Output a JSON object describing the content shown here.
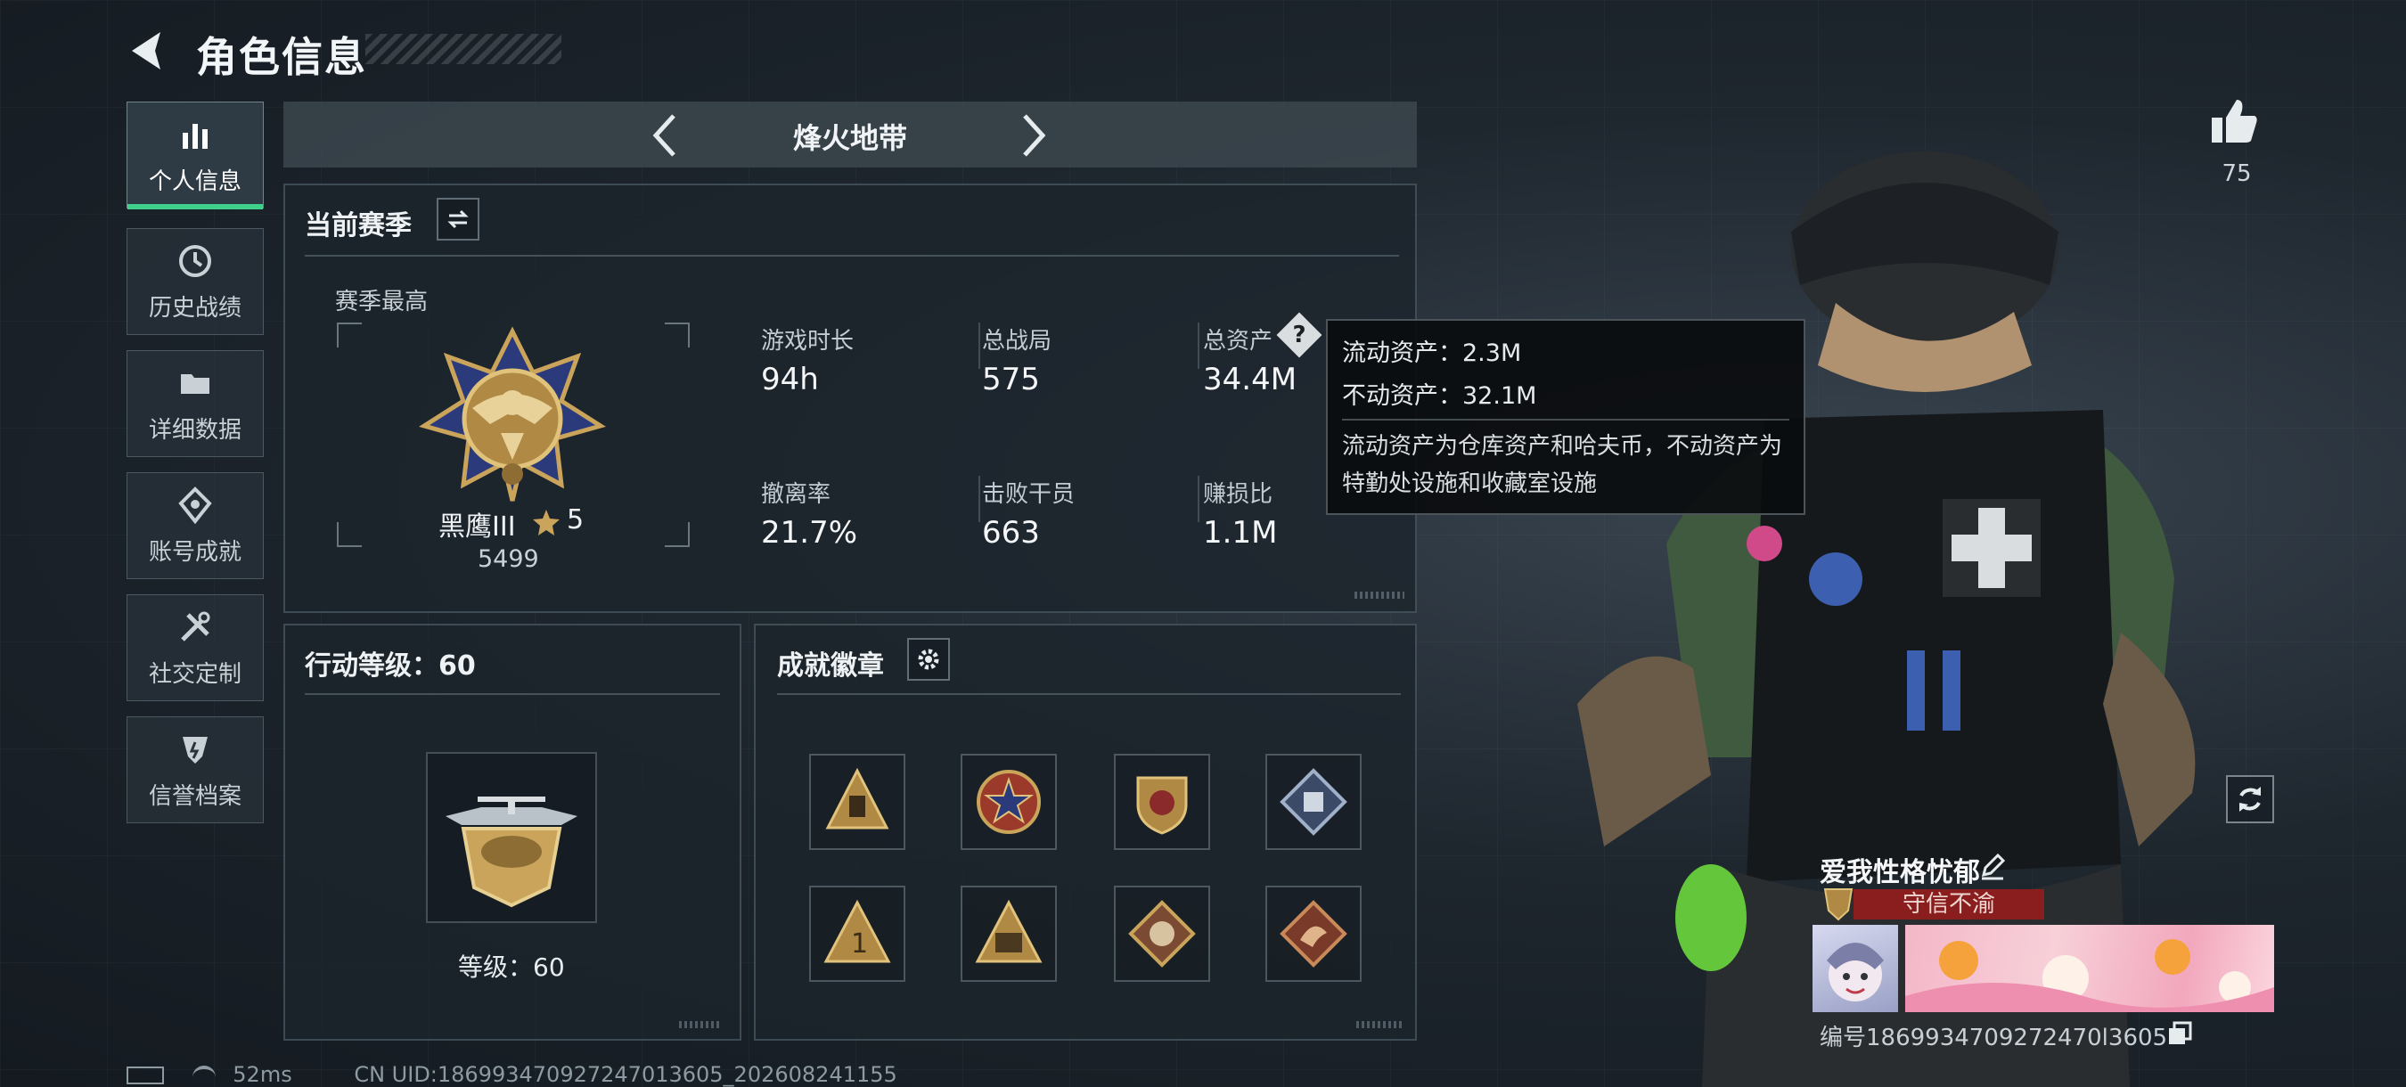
{
  "header": {
    "title": "角色信息"
  },
  "sidebar": {
    "items": [
      {
        "label": "个人信息",
        "icon": "bar-chart-icon",
        "active": true
      },
      {
        "label": "历史战绩",
        "icon": "history-icon"
      },
      {
        "label": "详细数据",
        "icon": "folder-icon"
      },
      {
        "label": "账号成就",
        "icon": "achievement-icon"
      },
      {
        "label": "社交定制",
        "icon": "tools-icon"
      },
      {
        "label": "信誉档案",
        "icon": "credit-shield-icon"
      }
    ]
  },
  "mode": {
    "title": "烽火地带"
  },
  "season": {
    "title": "当前赛季",
    "best_label": "赛季最高",
    "rank_name": "黑鹰III",
    "rank_stars": "5",
    "rank_points": "5499",
    "stats": [
      {
        "label": "游戏时长",
        "value": "94h"
      },
      {
        "label": "总战局",
        "value": "575"
      },
      {
        "label": "总资产",
        "value": "34.4M"
      },
      {
        "label": "撤离率",
        "value": "21.7%"
      },
      {
        "label": "击败干员",
        "value": "663"
      },
      {
        "label": "赚损比",
        "value": "1.1M"
      }
    ]
  },
  "tooltip": {
    "liquid": "流动资产：2.3M",
    "fixed": "不动资产：32.1M",
    "note": "流动资产为仓库资产和哈夫币，不动资产为特勤处设施和收藏室设施"
  },
  "action_level": {
    "title": "行动等级：60",
    "level_label": "等级：60"
  },
  "badges": {
    "title": "成就徽章",
    "items": [
      "badge-1",
      "badge-2",
      "badge-3",
      "badge-4",
      "badge-5",
      "badge-6",
      "badge-7",
      "badge-8"
    ]
  },
  "profile": {
    "likes": "75",
    "player_name": "爱我性格忧郁",
    "title_tag": "守信不渝",
    "uid_line": "编号1869934709272470l3605"
  },
  "status": {
    "ping": "52ms",
    "cn_uid": "CN UID:186993470927247013605_202608241155"
  },
  "colors": {
    "accent_green": "#3fd08c",
    "title_red": "#8a1e1e",
    "gold": "#c9a45a"
  }
}
